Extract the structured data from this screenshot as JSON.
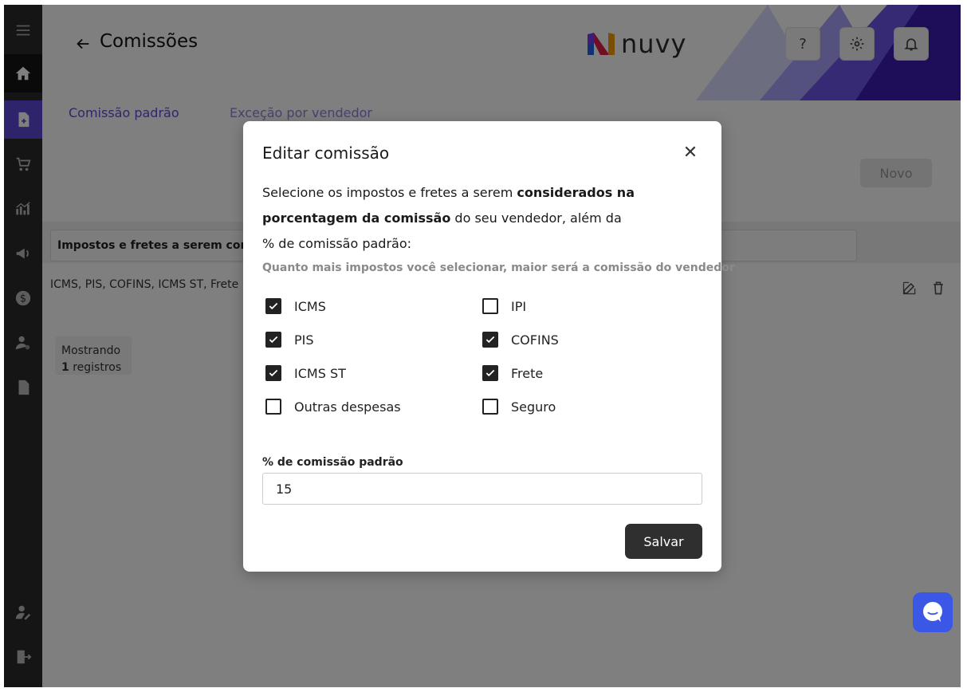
{
  "page": {
    "title": "Comissões"
  },
  "brand": {
    "logo_text": "nuvy",
    "accent": "#5d48d9",
    "tab_color": "#5b4fd8"
  },
  "header": {
    "help_label": "?",
    "settings_icon": "gear-icon",
    "notifications_icon": "bell-icon"
  },
  "sidebar": {
    "items": [
      {
        "icon": "menu-icon"
      },
      {
        "icon": "home-icon"
      },
      {
        "icon": "document-plus-icon"
      },
      {
        "icon": "cart-icon"
      },
      {
        "icon": "chart-icon"
      },
      {
        "icon": "megaphone-icon"
      },
      {
        "icon": "dollar-icon"
      },
      {
        "icon": "user-settings-icon"
      },
      {
        "icon": "file-icon"
      },
      {
        "icon": "user-edit-icon"
      },
      {
        "icon": "logout-icon"
      }
    ]
  },
  "tabs": [
    {
      "label": "Comissão padrão",
      "active": true
    },
    {
      "label": "Exceção por vendedor",
      "active": false
    }
  ],
  "content": {
    "new_button": "Novo",
    "table": {
      "header": "Impostos e fretes a serem considerados",
      "rows": [
        {
          "taxes": "ICMS, PIS, COFINS, ICMS ST, Frete"
        }
      ]
    },
    "pager": {
      "showing_label": "Mostrando",
      "count": "1",
      "count_suffix": "registros"
    }
  },
  "modal": {
    "title": "Editar comissão",
    "close_label": "✕",
    "desc_part1": "Selecione os impostos e fretes a serem ",
    "desc_bold": "considerados na porcentagem da comissão",
    "desc_part2": " do seu vendedor, além da % de comissão padrão:",
    "hint": "Quanto mais impostos você selecionar, maior será a comissão do vendedor",
    "options": [
      {
        "label": "ICMS",
        "checked": true
      },
      {
        "label": "IPI",
        "checked": false
      },
      {
        "label": "PIS",
        "checked": true
      },
      {
        "label": "COFINS",
        "checked": true
      },
      {
        "label": "ICMS ST",
        "checked": true
      },
      {
        "label": "Frete",
        "checked": true
      },
      {
        "label": "Outras despesas",
        "checked": false
      },
      {
        "label": "Seguro",
        "checked": false
      }
    ],
    "field_label": "% de comissão padrão",
    "field_value": "15",
    "save_label": "Salvar"
  }
}
